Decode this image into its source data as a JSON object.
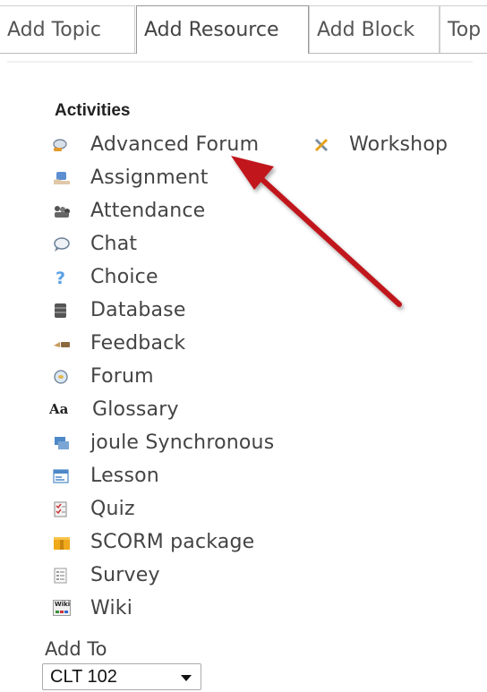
{
  "tabs": [
    {
      "label": "Add Topic"
    },
    {
      "label": "Add Resource"
    },
    {
      "label": "Add Block"
    },
    {
      "label": "Top"
    }
  ],
  "activities_heading": "Activities",
  "activities": [
    {
      "label": "Advanced Forum",
      "icon": "advanced-forum-icon"
    },
    {
      "label": "Workshop",
      "icon": "workshop-icon"
    },
    {
      "label": "Assignment",
      "icon": "assignment-icon"
    },
    {
      "label": "Attendance",
      "icon": "attendance-icon"
    },
    {
      "label": "Chat",
      "icon": "chat-icon"
    },
    {
      "label": "Choice",
      "icon": "choice-icon"
    },
    {
      "label": "Database",
      "icon": "database-icon"
    },
    {
      "label": "Feedback",
      "icon": "feedback-icon"
    },
    {
      "label": "Forum",
      "icon": "forum-icon"
    },
    {
      "label": "Glossary",
      "icon": "glossary-icon"
    },
    {
      "label": "joule Synchronous",
      "icon": "joule-synchronous-icon"
    },
    {
      "label": "Lesson",
      "icon": "lesson-icon"
    },
    {
      "label": "Quiz",
      "icon": "quiz-icon"
    },
    {
      "label": "SCORM package",
      "icon": "scorm-package-icon"
    },
    {
      "label": "Survey",
      "icon": "survey-icon"
    },
    {
      "label": "Wiki",
      "icon": "wiki-icon"
    }
  ],
  "glossary_icon_text": "Aa",
  "wiki_icon_text": "Wiki",
  "add_to": {
    "label": "Add To",
    "selected": "CLT 102"
  },
  "colors": {
    "arrow": "#c0161b",
    "text": "#444444",
    "tab_border": "#999999"
  }
}
